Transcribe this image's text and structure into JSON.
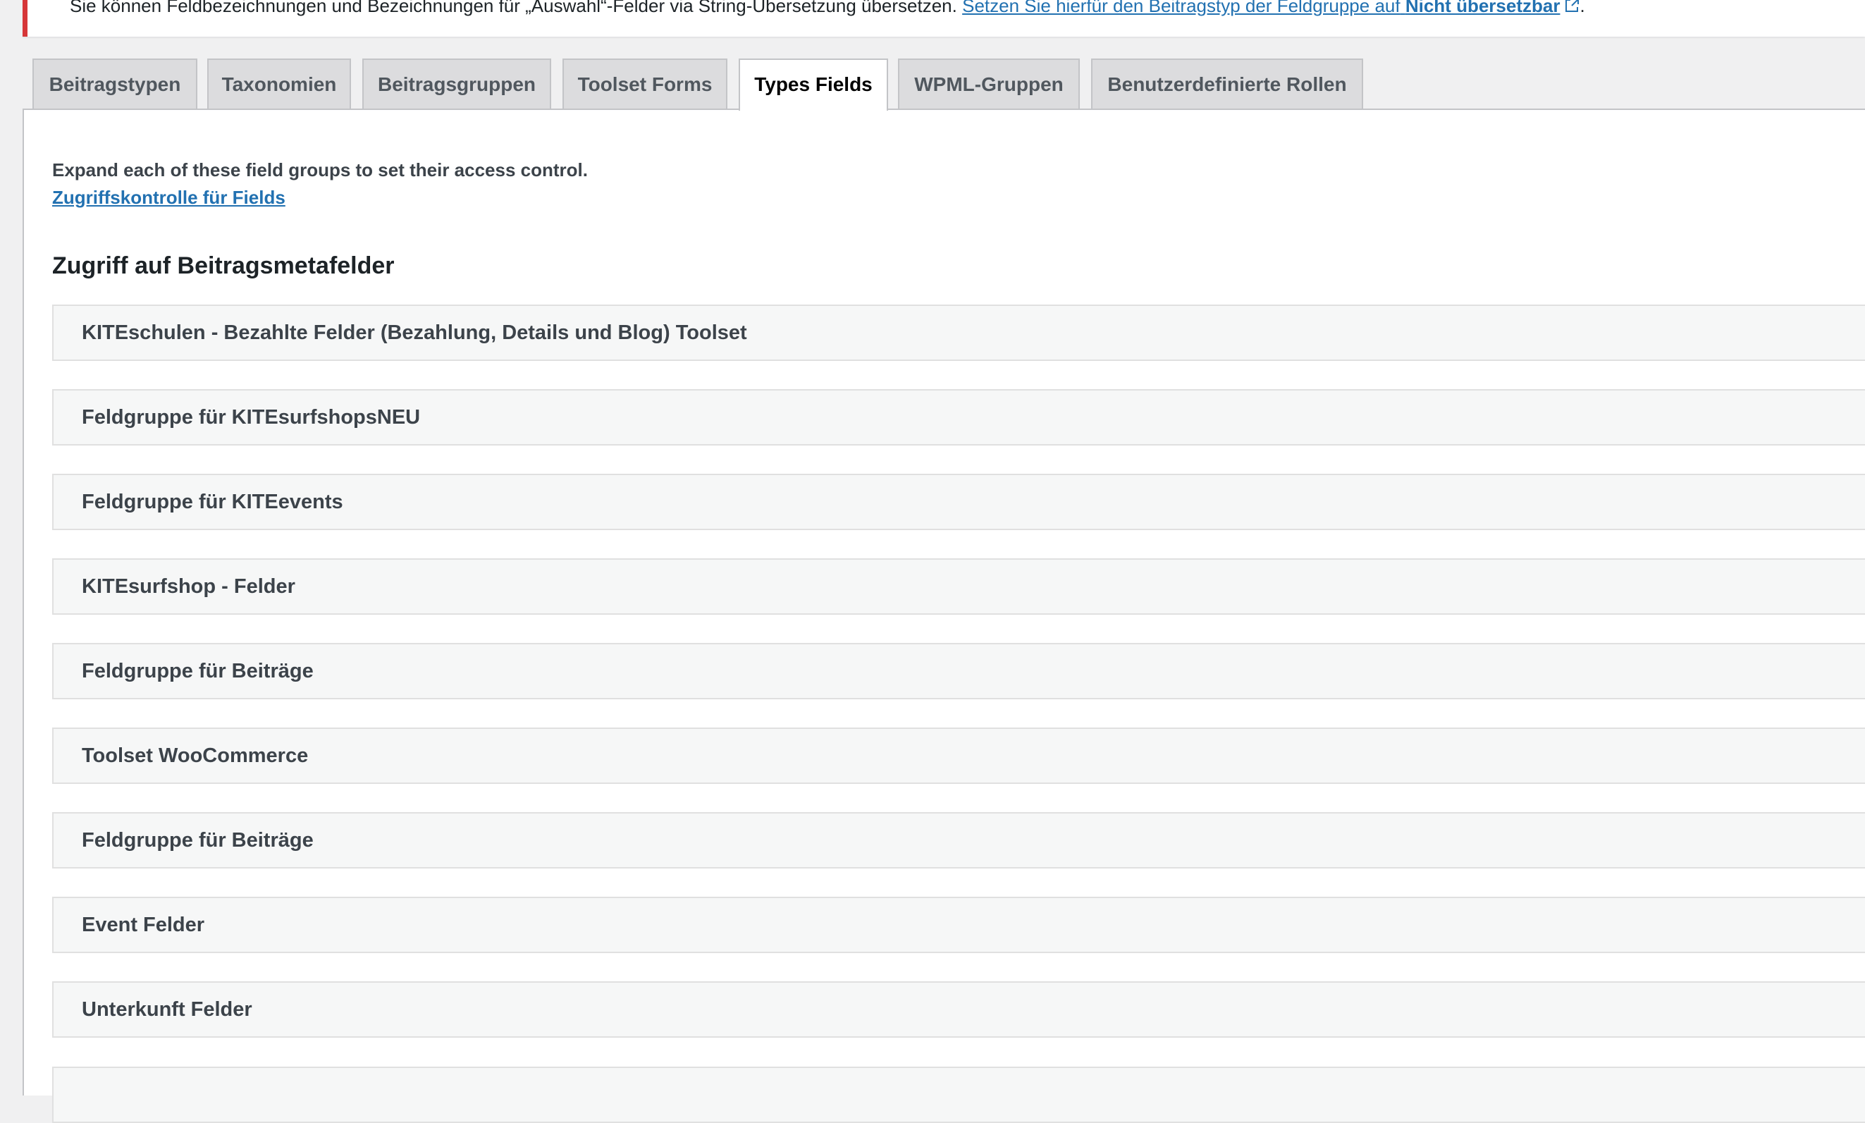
{
  "notice": {
    "text": "Sie können Feldbezeichnungen und Bezeichnungen für „Auswahl“-Felder via String-Übersetzung übersetzen.",
    "link_prefix": "Setzen Sie hierfür den Beitragstyp der Feldgruppe auf",
    "link_bold": "Nicht übersetzbar",
    "suffix": "."
  },
  "tabs": [
    {
      "label": "Beitragstypen"
    },
    {
      "label": "Taxonomien"
    },
    {
      "label": "Beitragsgruppen"
    },
    {
      "label": "Toolset Forms"
    },
    {
      "label": "Types Fields",
      "active": true
    },
    {
      "label": "WPML-Gruppen"
    },
    {
      "label": "Benutzerdefinierte Rollen"
    }
  ],
  "main": {
    "intro": "Expand each of these field groups to set their access control.",
    "intro_link": "Zugriffskontrolle für Fields",
    "section_heading": "Zugriff auf Beitragsmetafelder",
    "field_groups": [
      "KITEschulen - Bezahlte Felder (Bezahlung, Details und Blog) Toolset",
      "Feldgruppe für KITEsurfshopsNEU",
      "Feldgruppe für KITEevents",
      "KITEsurfshop - Felder",
      "Feldgruppe für Beiträge",
      "Toolset WooCommerce",
      "Feldgruppe für Beiträge",
      "Event Felder",
      "Unterkunft Felder",
      ""
    ]
  },
  "colors": {
    "accent_link": "#2271b1",
    "notice_error": "#d63638",
    "tab_inactive_bg": "#dcdcde",
    "page_bg": "#f0f0f1"
  }
}
